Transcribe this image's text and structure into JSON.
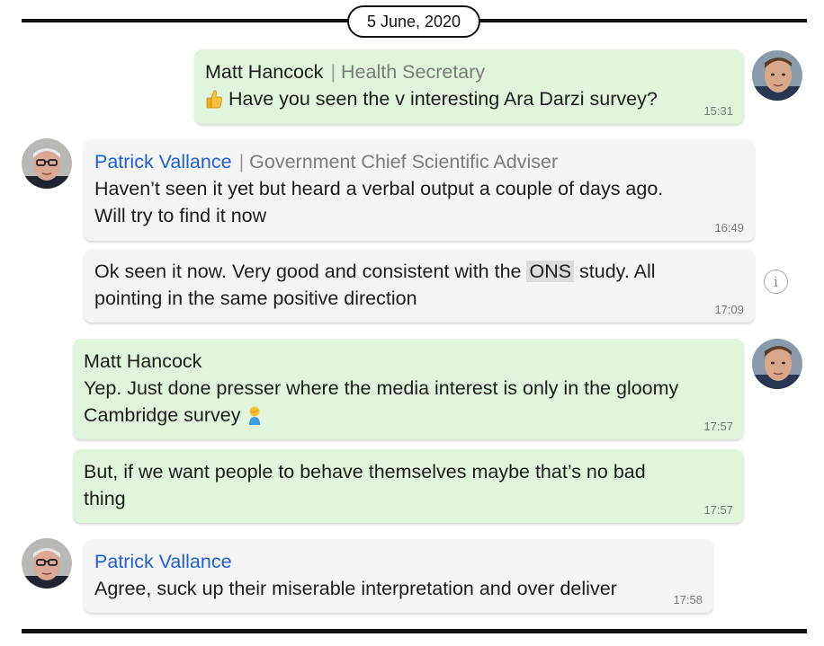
{
  "header": {
    "date": "5 June, 2020"
  },
  "messages": [
    {
      "sender": "Matt Hancock",
      "role": "Health Secretary",
      "separator": "|",
      "emoji": "thumbs-up",
      "text": "Have you seen the v interesting Ara Darzi survey?",
      "time": "15:31"
    },
    {
      "sender": "Patrick Vallance",
      "role": "Government Chief Scientific Adviser",
      "separator": "|",
      "lines": [
        "Haven’t seen it yet but heard a verbal output a couple of days ago.",
        "Will try to find it now"
      ],
      "time": "16:49"
    },
    {
      "line1_pre": "Ok seen it now. Very good and consistent with the",
      "highlight": "ONS",
      "line1_post": "study. All",
      "line2": "pointing in the same positive direction",
      "time": "17:09"
    },
    {
      "sender": "Matt Hancock",
      "line1": "Yep. Just done presser where the media interest is only in the gloomy",
      "line2": "Cambridge survey",
      "emoji": "person-facepalming",
      "time": "17:57"
    },
    {
      "lines": [
        "But, if we want people to behave themselves maybe that’s no bad",
        "thing"
      ],
      "time": "17:57"
    },
    {
      "sender": "Patrick Vallance",
      "text": "Agree, suck up their miserable interpretation and over deliver",
      "time": "17:58"
    }
  ],
  "info_icon": "info-icon"
}
